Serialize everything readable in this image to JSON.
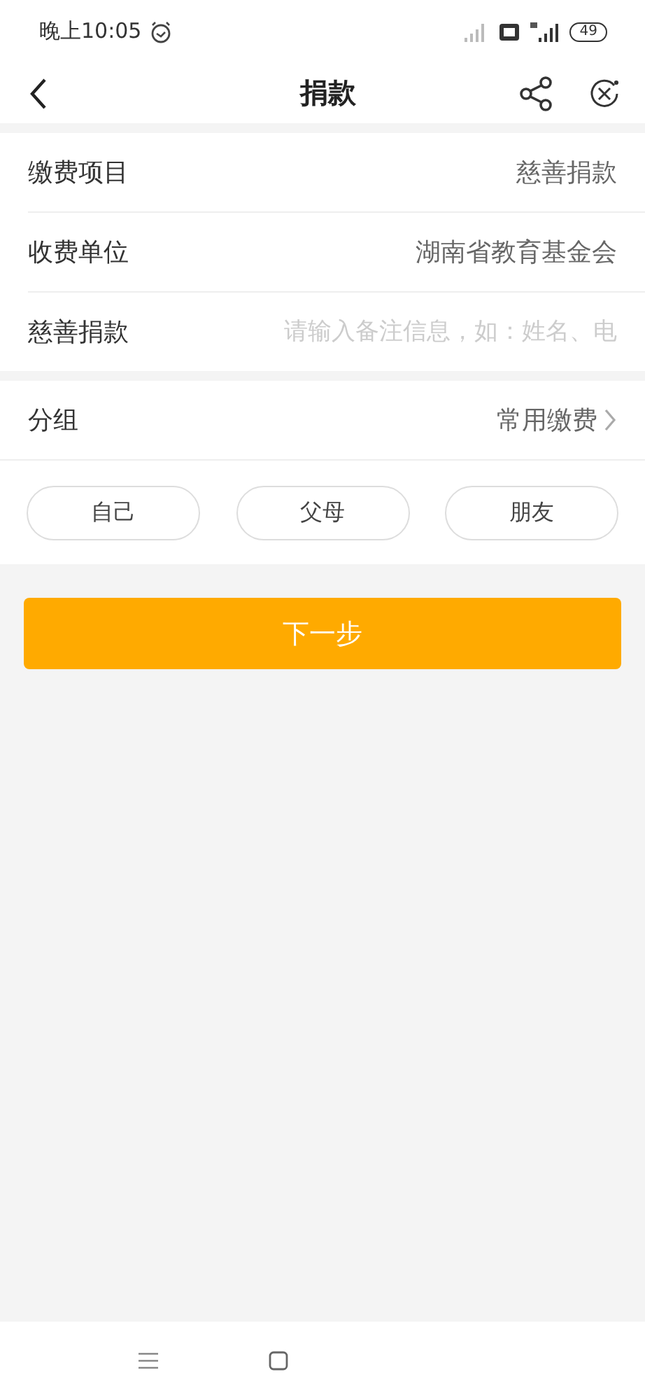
{
  "status_bar": {
    "time": "晚上10:05",
    "battery": "49"
  },
  "header": {
    "title": "捐款"
  },
  "form": [
    {
      "kind": "value",
      "label": "缴费项目",
      "value": "慈善捐款"
    },
    {
      "kind": "value",
      "label": "收费单位",
      "value": "湖南省教育基金会"
    },
    {
      "kind": "input",
      "label": "慈善捐款",
      "placeholder": "请输入备注信息，如：姓名、电"
    }
  ],
  "group": {
    "label": "分组",
    "value": "常用缴费",
    "chips": [
      "自己",
      "父母",
      "朋友"
    ]
  },
  "next_button": "下一步"
}
